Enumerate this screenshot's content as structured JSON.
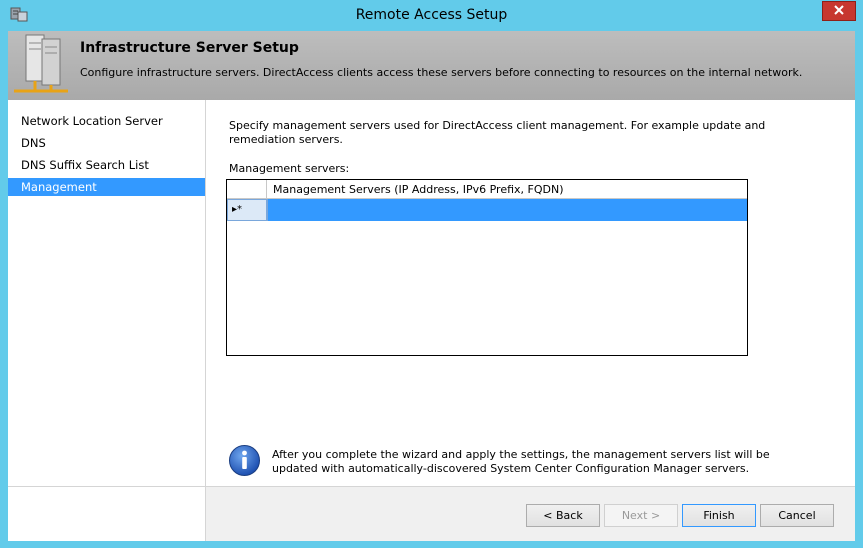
{
  "window": {
    "title": "Remote Access Setup"
  },
  "banner": {
    "title": "Infrastructure Server Setup",
    "subtitle": "Configure infrastructure servers. DirectAccess clients access these servers before connecting to resources on the internal network."
  },
  "nav": {
    "items": [
      {
        "label": "Network Location Server"
      },
      {
        "label": "DNS"
      },
      {
        "label": "DNS Suffix Search List"
      },
      {
        "label": "Management"
      }
    ],
    "selected": "Management"
  },
  "content": {
    "description": "Specify management servers used for DirectAccess client management. For example update and remediation servers.",
    "servers_label": "Management servers:",
    "grid": {
      "column_header": "Management Servers (IP Address, IPv6 Prefix, FQDN)",
      "new_row_marker": "▸*"
    },
    "info": "After you complete the wizard and apply the settings, the management servers list will be updated with automatically-discovered System Center Configuration Manager servers."
  },
  "footer": {
    "back_label": "< Back",
    "next_label": "Next >",
    "finish_label": "Finish",
    "cancel_label": "Cancel"
  },
  "icons": {
    "app": "server-app-icon",
    "close": "close-icon",
    "banner": "servers-icon",
    "info": "info-icon"
  },
  "colors": {
    "titlebar": "#62cbea",
    "selection": "#3399ff",
    "close": "#c7372f"
  }
}
